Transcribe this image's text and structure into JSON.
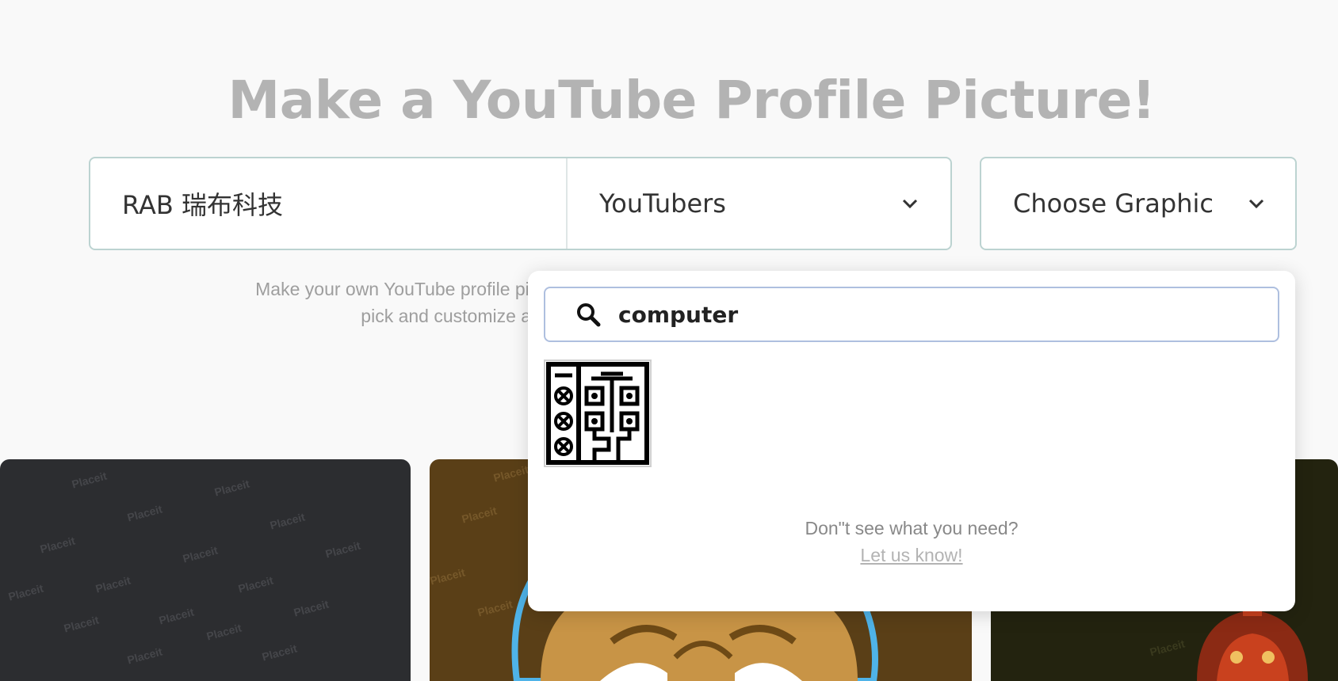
{
  "page": {
    "title": "Make a YouTube Profile Picture!",
    "description_line1": "Make your own YouTube profile picture in just a few click",
    "description_line2": "pick and customize a template"
  },
  "form": {
    "name_value": "RAB 瑞布科技",
    "category_selected": "YouTubers",
    "graphic_selected": "Choose Graphic"
  },
  "dropdown": {
    "search_value": "computer",
    "results": [
      {
        "icon": "computer-circuit-icon"
      }
    ],
    "help_text": "Don\"t see what you need?",
    "help_link": "Let us know!"
  },
  "cards": {
    "watermark": "Placeit"
  },
  "colors": {
    "title": "#b3b3b3",
    "border": "#bcd3d1",
    "search_border": "#aebfdf",
    "card_dark": "#2c2d30",
    "card_brown": "#5a3f17",
    "card_olive": "#23230f"
  }
}
